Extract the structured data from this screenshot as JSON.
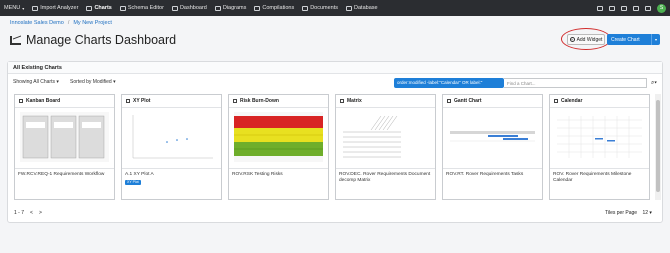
{
  "nav": {
    "menu": "MENU",
    "items": [
      "Import Analyzer",
      "Charts",
      "Schema Editor",
      "Dashboard",
      "Diagrams",
      "Compilations",
      "Documents",
      "Database"
    ],
    "avatar": "S"
  },
  "breadcrumb": [
    "Innoslate Sales Demo",
    "My New Project"
  ],
  "title": "Manage Charts Dashboard",
  "buttons": {
    "add_widget": "Add Widget",
    "create_chart": "Create Chart"
  },
  "panel": {
    "header": "All Existing Charts",
    "showing": "Showing All Charts",
    "sorted": "Sorted by Modified",
    "filter": "order:modified -label:\"Calendar\" OR label:\"",
    "search_placeholder": "Find a Chart..."
  },
  "tiles": [
    {
      "title": "Kanban Board",
      "caption": "FW.RCV.REQ-1 Requirements Workflow",
      "badge": ""
    },
    {
      "title": "XY Plot",
      "caption": "A.1 XY Plot A",
      "badge": "XY Plot"
    },
    {
      "title": "Risk Burn-Down",
      "caption": "ROV.RSK Testing Risks",
      "badge": ""
    },
    {
      "title": "Matrix",
      "caption": "ROV.DEC. Rover Requirements Document decomp Matrix",
      "badge": ""
    },
    {
      "title": "Gantt Chart",
      "caption": "ROV.RT. Rover Requirements Tasks",
      "badge": ""
    },
    {
      "title": "Calendar",
      "caption": "ROV. Rover Requirements Milestone Calendar",
      "badge": ""
    }
  ],
  "pager": {
    "range": "1 - 7",
    "prev": "<",
    "next": ">"
  },
  "per_page": {
    "label": "Tiles per Page",
    "value": "12"
  },
  "colors": {
    "accent": "#1e7fd8",
    "highlight": "#d12b2b",
    "nav": "#2b2d31"
  }
}
